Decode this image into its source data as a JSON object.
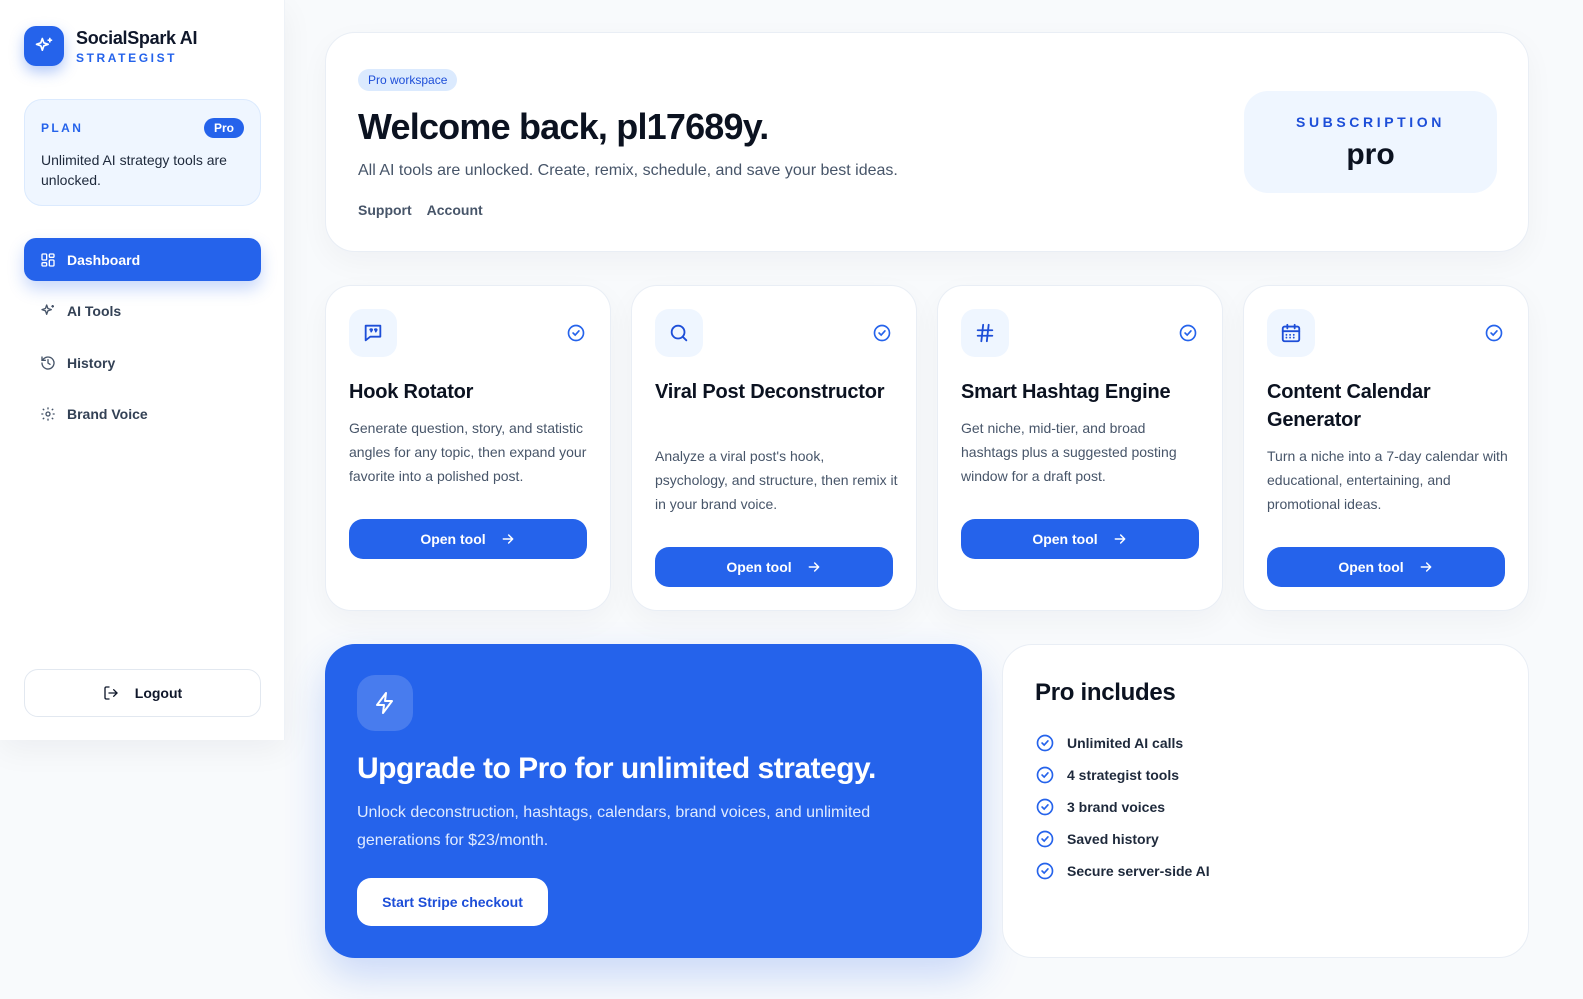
{
  "colors": {
    "accent": "#2563eb",
    "accent_soft": "#eff6ff",
    "text": "#0f172a",
    "muted": "#475569"
  },
  "brand": {
    "name": "SocialSpark AI",
    "subtitle": "STRATEGIST",
    "icon": "sparkles-icon"
  },
  "plan": {
    "label": "PLAN",
    "badge": "Pro",
    "description": "Unlimited AI strategy tools are unlocked."
  },
  "nav": {
    "items": [
      {
        "label": "Dashboard",
        "icon": "grid-icon",
        "active": true
      },
      {
        "label": "AI Tools",
        "icon": "sparkles-icon",
        "active": false
      },
      {
        "label": "History",
        "icon": "history-icon",
        "active": false
      },
      {
        "label": "Brand Voice",
        "icon": "gear-icon",
        "active": false
      }
    ],
    "logout": "Logout"
  },
  "hero": {
    "pill": "Pro workspace",
    "title": "Welcome back, pl17689y.",
    "description": "All AI tools are unlocked. Create, remix, schedule, and save your best ideas.",
    "links": [
      "Support",
      "Account"
    ],
    "subscription_label": "SUBSCRIPTION",
    "subscription_value": "pro"
  },
  "tools": [
    {
      "title": "Hook Rotator",
      "description": "Generate question, story, and statistic angles for any topic, then expand your favorite into a polished post.",
      "button": "Open tool",
      "icon": "chat-icon"
    },
    {
      "title": "Viral Post Deconstructor",
      "description": "Analyze a viral post's hook, psychology, and structure, then remix it in your brand voice.",
      "button": "Open tool",
      "icon": "search-icon"
    },
    {
      "title": "Smart Hashtag Engine",
      "description": "Get niche, mid-tier, and broad hashtags plus a suggested posting window for a draft post.",
      "button": "Open tool",
      "icon": "hashtag-icon"
    },
    {
      "title": "Content Calendar Generator",
      "description": "Turn a niche into a 7-day calendar with educational, entertaining, and promotional ideas.",
      "button": "Open tool",
      "icon": "calendar-icon"
    }
  ],
  "upgrade": {
    "title": "Upgrade to Pro for unlimited strategy.",
    "description": "Unlock deconstruction, hashtags, calendars, brand voices, and unlimited generations for $23/month.",
    "button": "Start Stripe checkout",
    "icon": "lightning-icon"
  },
  "includes": {
    "title": "Pro includes",
    "items": [
      "Unlimited AI calls",
      "4 strategist tools",
      "3 brand voices",
      "Saved history",
      "Secure server-side AI"
    ]
  }
}
